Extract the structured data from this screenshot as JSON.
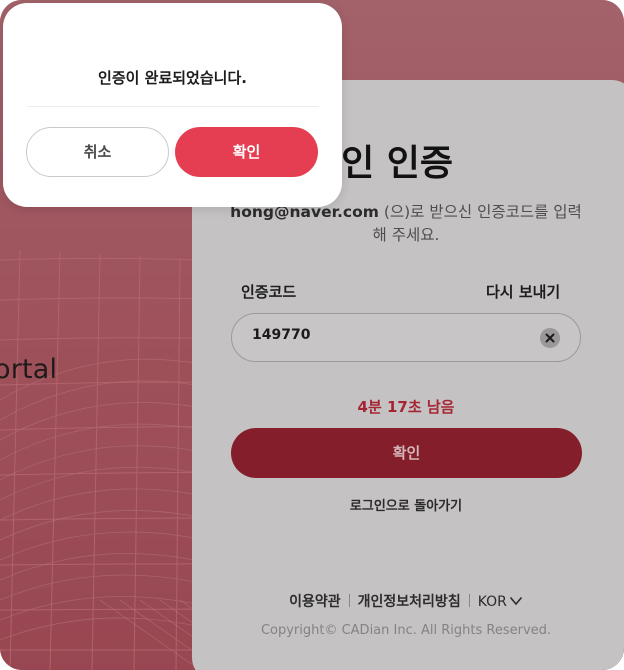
{
  "background": {
    "portal_text": "ortal",
    "accent_color": "#e53e52"
  },
  "verify": {
    "title": "본인 인증",
    "email": "hong@naver.com",
    "desc_rest": " (으)로 받으신 인증코드를 입력 해 주세요.",
    "code_label": "인증코드",
    "resend_label": "다시 보내기",
    "code_value": "149770",
    "clear_icon": "close-icon",
    "timer": "4분 17초 남음",
    "confirm_label": "확인",
    "back_label": "로그인으로 돌아가기"
  },
  "footer": {
    "terms": "이용약관",
    "privacy": "개인정보처리방침",
    "lang": "KOR",
    "lang_icon": "chevron-down-icon",
    "copyright": "Copyright© CADian Inc. All Rights Reserved."
  },
  "modal": {
    "message": "인증이 완료되었습니다.",
    "cancel_label": "취소",
    "ok_label": "확인"
  }
}
